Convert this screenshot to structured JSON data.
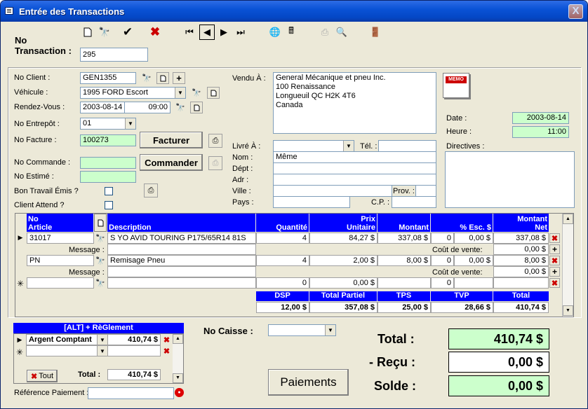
{
  "window": {
    "title": "Entrée des Transactions",
    "close": "X"
  },
  "header": {
    "no_label": "No",
    "transaction_label": "Transaction :",
    "transaction_value": "295"
  },
  "left": {
    "client_label": "No Client :",
    "client_value": "GEN1355",
    "vehicule_label": "Véhicule :",
    "vehicule_value": "1995 FORD Escort",
    "rdv_label": "Rendez-Vous :",
    "rdv_date": "2003-08-14",
    "rdv_time": "09:00",
    "entrepot_label": "No Entrepôt :",
    "entrepot_value": "01",
    "facture_label": "No Facture :",
    "facture_value": "100273",
    "facturer_btn": "Facturer",
    "commande_label": "No Commande :",
    "commande_value": "",
    "commander_btn": "Commander",
    "estime_label": "No Estimé :",
    "estime_value": "",
    "bon_label": "Bon Travail Émis ?",
    "client_attend_label": "Client Attend ?"
  },
  "vendu": {
    "label": "Vendu À :",
    "lines": [
      "General Mécanique et pneu Inc.",
      "100 Renaissance",
      "Longueuil  QC  H2K 4T6",
      "Canada"
    ]
  },
  "memo": "MEMO",
  "dateheure": {
    "date_label": "Date :",
    "date_value": "2003-08-14",
    "heure_label": "Heure :",
    "heure_value": "11:00",
    "directives_label": "Directives :"
  },
  "livre": {
    "label": "Livré À :",
    "tel_label": "Tél. :",
    "nom_label": "Nom :",
    "nom_value": "Même",
    "dept_label": "Dépt :",
    "adr_label": "Adr :",
    "ville_label": "Ville :",
    "prov_label": "Prov. :",
    "pays_label": "Pays :",
    "cp_label": "C.P. :"
  },
  "grid": {
    "headers": {
      "no_article_1": "No",
      "no_article_2": "Article",
      "description": "Description",
      "quantite": "Quantité",
      "prix_1": "Prix",
      "prix_2": "Unitaire",
      "montant": "Montant",
      "esc": "% Esc. $",
      "net_1": "Montant",
      "net_2": "Net"
    },
    "rows": [
      {
        "article": "31017",
        "description": "S  YO AVID TOURING  P175/65R14 81S",
        "quantite": "4",
        "prix": "84,27 $",
        "montant": "337,08 $",
        "esc_pct": "0",
        "esc_amt": "0,00 $",
        "net": "337,08 $",
        "message_label": "Message :",
        "cout_label": "Coût de vente:",
        "cout_value": "0,00 $"
      },
      {
        "article": "PN",
        "description": "Remisage Pneu",
        "quantite": "4",
        "prix": "2,00 $",
        "montant": "8,00 $",
        "esc_pct": "0",
        "esc_amt": "0,00 $",
        "net": "8,00 $",
        "message_label": "Message :",
        "cout_label": "Coût de vente:",
        "cout_value": "0,00 $"
      }
    ],
    "new_row": {
      "quantite": "0",
      "prix": "0,00 $",
      "esc_pct": "0"
    }
  },
  "totals": {
    "dsp_label": "DSP",
    "partiel_label": "Total Partiel",
    "tps_label": "TPS",
    "tvp_label": "TVP",
    "total_label": "Total",
    "dsp": "12,00 $",
    "partiel": "357,08 $",
    "tps": "25,00 $",
    "tvp": "28,66 $",
    "total": "410,74 $"
  },
  "reglement": {
    "header": "[ALT] + RèGlement",
    "mode": "Argent Comptant",
    "montant": "410,74 $",
    "tout_btn": "Tout",
    "total_label": "Total :",
    "total_value": "410,74 $",
    "ref_label": "Référence Paiement :"
  },
  "caisse": {
    "label": "No Caisse :",
    "value": ""
  },
  "paiements_btn": "Paiements",
  "summary": {
    "total_label": "Total :",
    "total_value": "410,74 $",
    "recu_label": "- Reçu :",
    "recu_value": "0,00 $",
    "solde_label": "Solde :",
    "solde_value": "0,00 $"
  }
}
